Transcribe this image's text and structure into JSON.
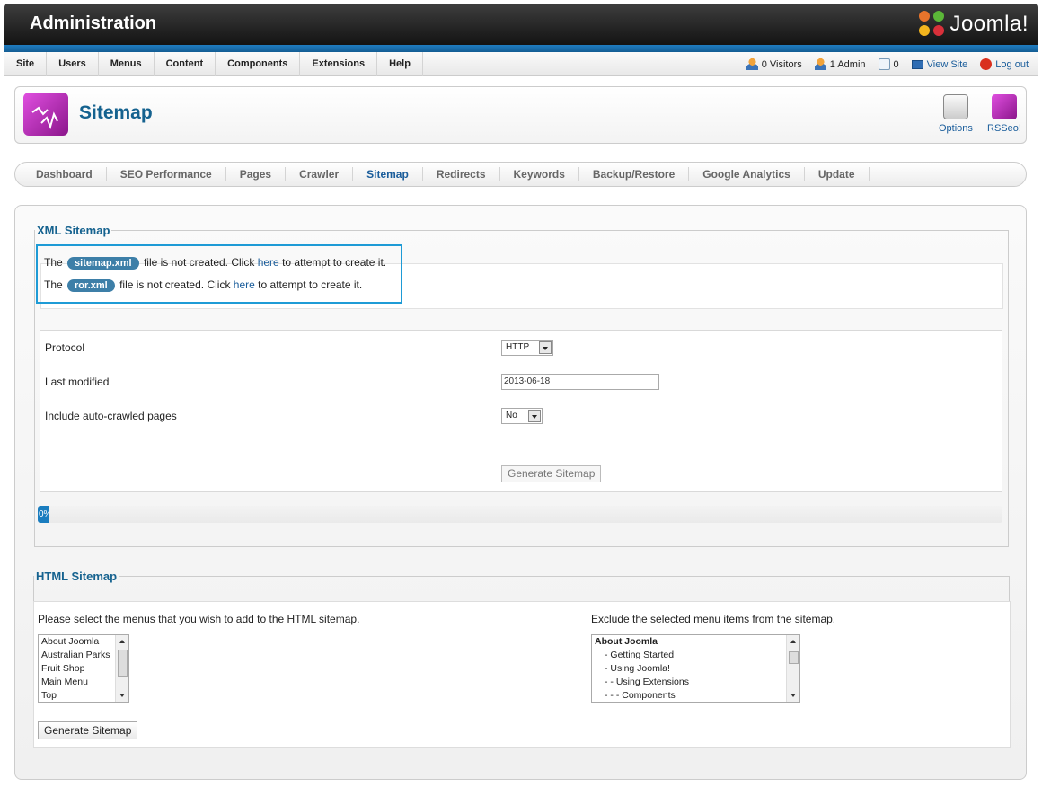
{
  "header": {
    "title": "Administration",
    "logo_text": "Joomla!"
  },
  "menu": [
    "Site",
    "Users",
    "Menus",
    "Content",
    "Components",
    "Extensions",
    "Help"
  ],
  "status": {
    "visitors": "0 Visitors",
    "admins": "1 Admin",
    "messages": "0",
    "view_site": "View Site",
    "logout": "Log out"
  },
  "toolbar": {
    "page_title": "Sitemap",
    "options_label": "Options",
    "rsseo_label": "RSSeo!"
  },
  "tabs": [
    "Dashboard",
    "SEO Performance",
    "Pages",
    "Crawler",
    "Sitemap",
    "Redirects",
    "Keywords",
    "Backup/Restore",
    "Google Analytics",
    "Update"
  ],
  "active_tab": "Sitemap",
  "xml_sitemap": {
    "legend": "XML Sitemap",
    "notices": [
      {
        "prefix": "The",
        "file": "sitemap.xml",
        "middle": "file is not created. Click",
        "link": "here",
        "suffix": "to attempt to create it."
      },
      {
        "prefix": "The",
        "file": "ror.xml",
        "middle": "file is not created. Click",
        "link": "here",
        "suffix": "to attempt to create it."
      }
    ],
    "protocol_label": "Protocol",
    "protocol_value": "HTTP",
    "last_modified_label": "Last modified",
    "last_modified_value": "2013-06-18",
    "auto_crawled_label": "Include auto-crawled pages",
    "auto_crawled_value": "No",
    "generate_label": "Generate Sitemap",
    "progress_text": "0%",
    "progress_value": 0
  },
  "html_sitemap": {
    "legend": "HTML Sitemap",
    "menus_prompt": "Please select the menus that you wish to add to the HTML sitemap.",
    "menus": [
      "About Joomla",
      "Australian Parks",
      "Fruit Shop",
      "Main Menu",
      "Top"
    ],
    "exclude_prompt": "Exclude the selected menu items from the sitemap.",
    "exclude_items": [
      "About Joomla",
      "- Getting Started",
      "- Using Joomla!",
      "- - Using Extensions",
      "- - - Components"
    ],
    "generate_label": "Generate Sitemap"
  },
  "colors": {
    "accent": "#15628f",
    "highlight": "#1e9bd6",
    "pill": "#3d7fa8",
    "rsseo": "#c23ac2"
  }
}
